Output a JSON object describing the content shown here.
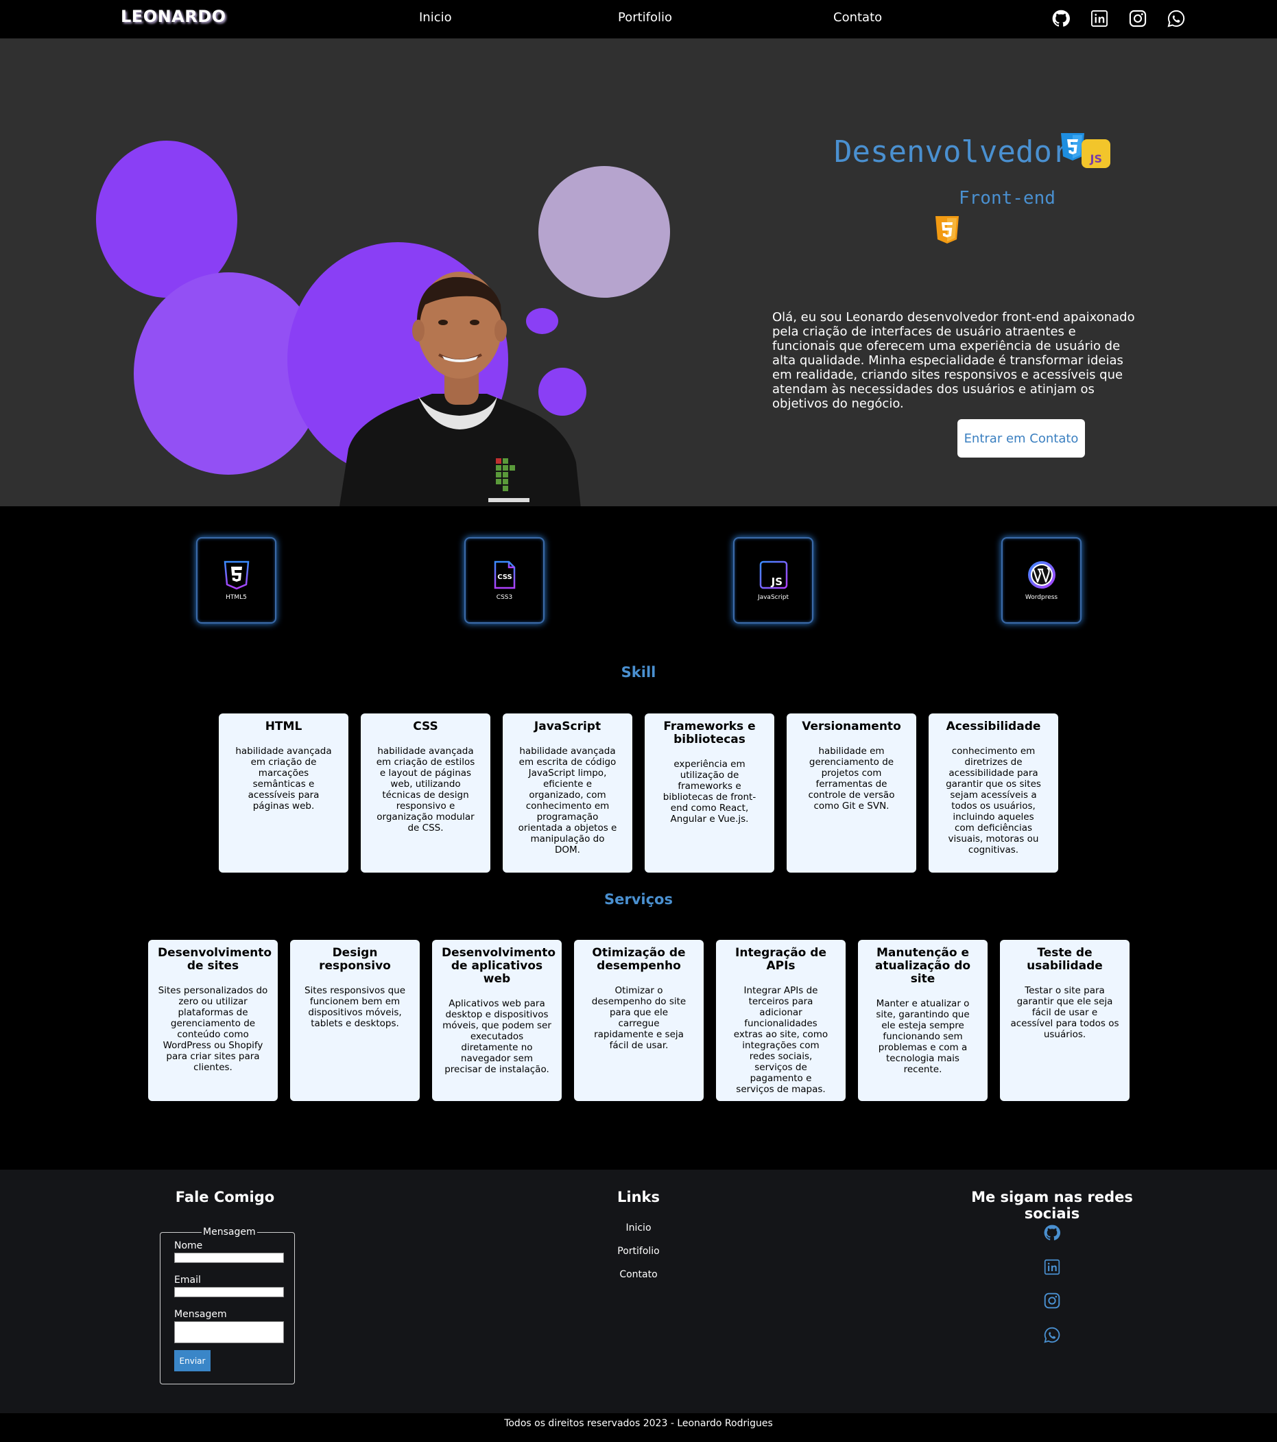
{
  "nav": {
    "logo": "LEONARDO",
    "links": [
      "Inicio",
      "Portifolio",
      "Contato"
    ],
    "social_icons": [
      "github-icon",
      "linkedin-icon",
      "instagram-icon",
      "whatsapp-icon"
    ]
  },
  "hero": {
    "title": "Desenvolvedor",
    "subtitle": "Front-end",
    "intro": "Olá, eu sou Leonardo desenvolvedor front-end apaixonado pela criação de interfaces de usuário atraentes e funcionais que oferecem uma experiência de usuário de alta qualidade. Minha especialidade é transformar ideias em realidade, criando sites responsivos e acessíveis que atendam às necessidades dos usuários e atinjam os objetivos do negócio.",
    "button": "Entrar em Contato",
    "badges": [
      "css3-badge-icon",
      "js-badge-icon",
      "html5-badge-icon"
    ]
  },
  "tech": [
    {
      "label": "HTML5",
      "icon": "html5-icon"
    },
    {
      "label": "CSS3",
      "icon": "css3-icon"
    },
    {
      "label": "JavaScript",
      "icon": "javascript-icon"
    },
    {
      "label": "Wordpress",
      "icon": "wordpress-icon"
    }
  ],
  "skill": {
    "title": "Skill",
    "cards": [
      {
        "title": "HTML",
        "text": "habilidade avançada em criação de marcações semânticas e acessíveis para páginas web."
      },
      {
        "title": "CSS",
        "text": "habilidade avançada em criação de estilos e layout de páginas web, utilizando técnicas de design responsivo e organização modular de CSS."
      },
      {
        "title": "JavaScript",
        "text": "habilidade avançada em escrita de código JavaScript limpo, eficiente e organizado, com conhecimento em programação orientada a objetos e manipulação do DOM."
      },
      {
        "title": "Frameworks e bibliotecas",
        "text": "experiência em utilização de frameworks e bibliotecas de front-end como React, Angular e Vue.js."
      },
      {
        "title": "Versionamento",
        "text": "habilidade em gerenciamento de projetos com ferramentas de controle de versão como Git e SVN."
      },
      {
        "title": "Acessibilidade",
        "text": "conhecimento em diretrizes de acessibilidade para garantir que os sites sejam acessíveis a todos os usuários, incluindo aqueles com deficiências visuais, motoras ou cognitivas."
      }
    ]
  },
  "services": {
    "title": "Serviços",
    "cards": [
      {
        "title": "Desenvolvimento de sites",
        "text": "Sites personalizados do zero ou utilizar plataformas de gerenciamento de conteúdo como WordPress ou Shopify para criar sites para clientes."
      },
      {
        "title": "Design responsivo",
        "text": "Sites responsivos que funcionem bem em dispositivos móveis, tablets e desktops."
      },
      {
        "title": "Desenvolvimento de aplicativos web",
        "text": "Aplicativos web para desktop e dispositivos móveis, que podem ser executados diretamente no navegador sem precisar de instalação."
      },
      {
        "title": "Otimização de desempenho",
        "text": "Otimizar o desempenho do site para que ele carregue rapidamente e seja fácil de usar."
      },
      {
        "title": "Integração de APIs",
        "text": "Integrar APIs de terceiros para adicionar funcionalidades extras ao site, como integrações com redes sociais, serviços de pagamento e serviços de mapas."
      },
      {
        "title": "Manutenção e atualização do site",
        "text": "Manter e atualizar o site, garantindo que ele esteja sempre funcionando sem problemas e com a tecnologia mais recente."
      },
      {
        "title": "Teste de usabilidade",
        "text": "Testar o site para garantir que ele seja fácil de usar e acessível para todos os usuários."
      }
    ]
  },
  "footer": {
    "contact_title": "Fale Comigo",
    "form_legend": "Mensagem",
    "name_label": "Nome",
    "email_label": "Email",
    "message_label": "Mensagem",
    "send_button": "Enviar",
    "links_title": "Links",
    "links": [
      "Inicio",
      "Portifolio",
      "Contato"
    ],
    "social_title": "Me sigam nas redes sociais",
    "social_icons": [
      "github-icon",
      "linkedin-icon",
      "instagram-icon",
      "whatsapp-icon"
    ],
    "copyright": "Todos os direitos reservados 2023 - Leonardo Rodrigues"
  },
  "colors": {
    "accent": "#4a90d0",
    "purple": "#8a3ff5",
    "light_purple": "#b6a4ce",
    "card_bg": "#eef6ff",
    "hero_bg": "#303030",
    "footer_bg": "#141518"
  }
}
